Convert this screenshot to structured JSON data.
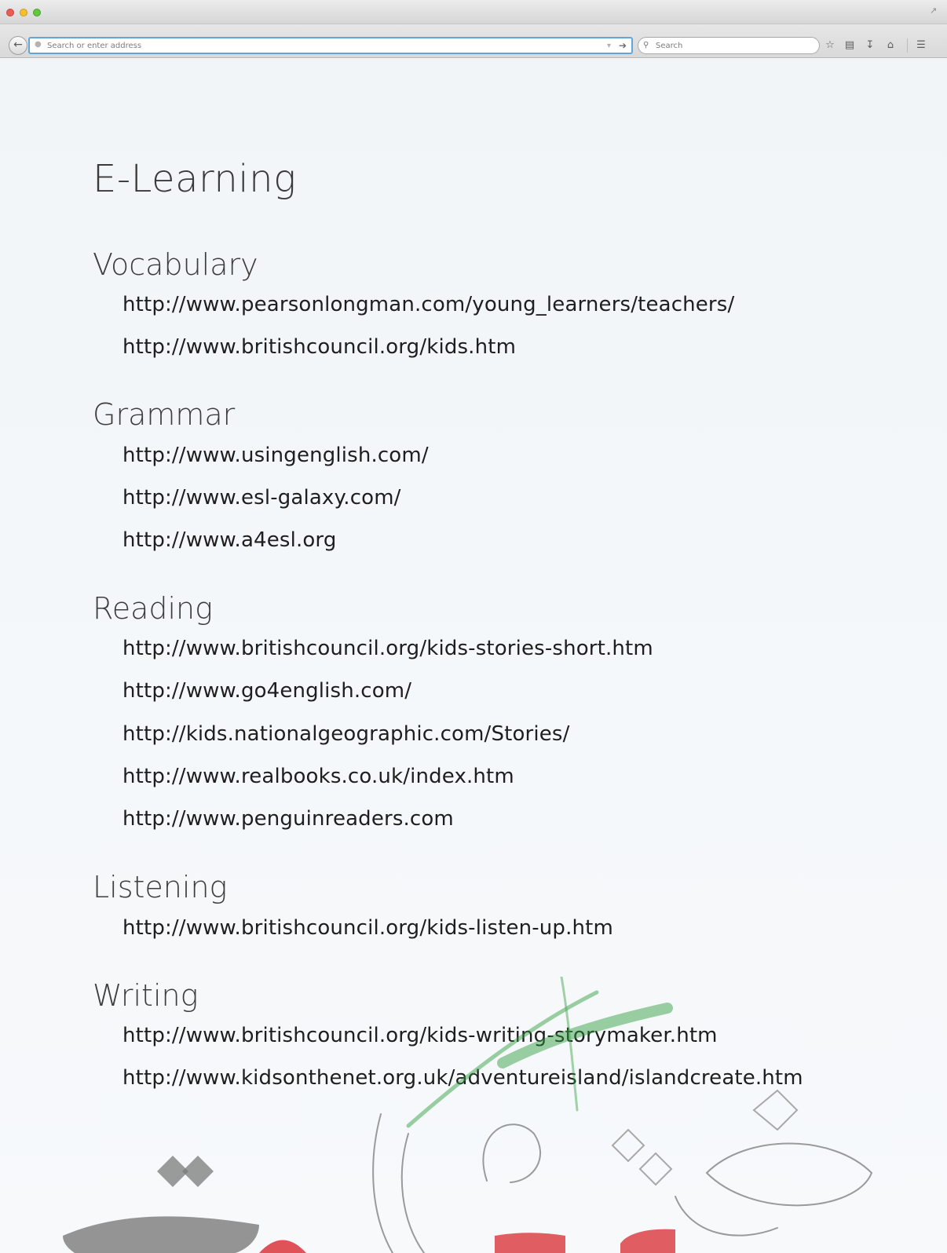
{
  "browser": {
    "urlbar_placeholder": "Search or enter address",
    "search_placeholder": "Search",
    "icons": {
      "back": "back-arrow-icon",
      "go": "go-arrow-icon",
      "search": "magnifier-icon",
      "bookmark": "star-icon",
      "library": "clipboard-icon",
      "downloads": "download-arrow-icon",
      "home": "home-icon",
      "menu": "hamburger-menu-icon"
    }
  },
  "page": {
    "title": "E-Learning",
    "sections": [
      {
        "heading": "Vocabulary",
        "links": [
          "http://www.pearsonlongman.com/young_learners/teachers/",
          "http://www.britishcouncil.org/kids.htm"
        ]
      },
      {
        "heading": "Grammar",
        "links": [
          "http://www.usingenglish.com/",
          "http://www.esl-galaxy.com/",
          "http://www.a4esl.org"
        ]
      },
      {
        "heading": "Reading",
        "links": [
          "http://www.britishcouncil.org/kids-stories-short.htm",
          "http://www.go4english.com/",
          "http://kids.nationalgeographic.com/Stories/",
          "http://www.realbooks.co.uk/index.htm",
          "http://www.penguinreaders.com"
        ]
      },
      {
        "heading": "Listening",
        "links": [
          "http://www.britishcouncil.org/kids-listen-up.htm"
        ]
      },
      {
        "heading": "Writing",
        "links": [
          "http://www.britishcouncil.org/kids-writing-storymaker.htm",
          "http://www.kidsonthenet.org.uk/adventureisland/islandcreate.htm"
        ]
      }
    ]
  },
  "colors": {
    "text": "#1e1e1e",
    "heading": "#3d3d3d",
    "urlbar_focus": "#63a5d8",
    "watermark_green": "#2e9b3a",
    "watermark_red": "#d8282e",
    "watermark_gray": "#7a7a7a"
  }
}
